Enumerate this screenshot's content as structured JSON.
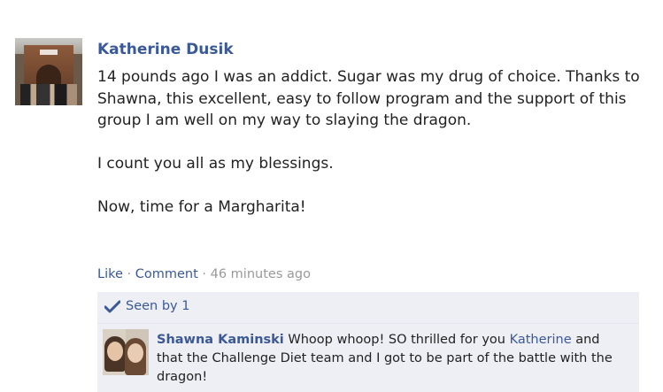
{
  "post": {
    "author": "Katherine Dusik",
    "paragraphs": [
      "14 pounds ago I was an addict. Sugar was my drug of choice. Thanks to Shawna, this excellent, easy to follow program and the support of this group I am well on my way to slaying the dragon.",
      "I count you all as my blessings.",
      "Now, time for a Margharita!"
    ],
    "actions": {
      "like": "Like",
      "separator": " · ",
      "comment": "Comment",
      "time": "46 minutes ago"
    },
    "seen": {
      "icon": "checkmark-icon",
      "label": "Seen by 1"
    }
  },
  "comment": {
    "author": "Shawna Kaminski",
    "text_before": " Whoop whoop! SO thrilled for you ",
    "mention": "Katherine",
    "text_after": " and that the Challenge Diet team and I got to be part of the battle with the dragon!"
  },
  "colors": {
    "link": "#3b5998",
    "text": "#222222",
    "muted": "#999999",
    "panel": "#edeff4"
  }
}
